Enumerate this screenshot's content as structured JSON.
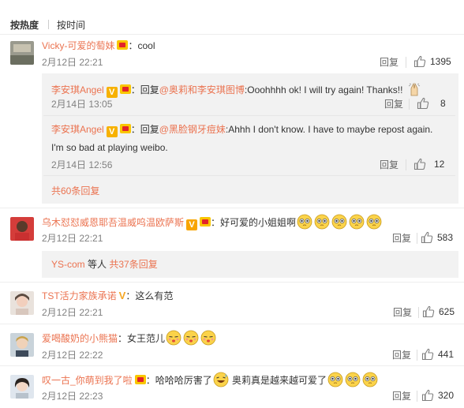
{
  "tabs": {
    "hot": "按热度",
    "time": "按时间"
  },
  "actions": {
    "reply": "回复"
  },
  "comments": [
    {
      "user": "Vicky-可爱的萄妹",
      "colon": "：",
      "text": "cool",
      "time": "2月12日 22:21",
      "likes": "1395",
      "subs": [
        {
          "user": "李安琪Angel",
          "colon": "：回复",
          "mention": "@奥莉和李安琪图博",
          "text": ":Ooohhhh ok! I will try again! Thanks!! ",
          "time": "2月14日 13:05",
          "likes": "8"
        },
        {
          "user": "李安琪Angel",
          "colon": "：回复",
          "mention": "@黑脸钢牙痘妹",
          "text": ":Ahhh I don't know. I have to maybe repost again.",
          "text2": "I'm so bad at playing weibo.",
          "time": "2月14日 12:56",
          "likes": "12"
        }
      ],
      "more": "共60条回复"
    },
    {
      "user": "乌木怼怼威恩耶吾温威呜温欧萨斯",
      "colon": "：",
      "text": "好可爱的小姐姐啊",
      "time": "2月12日 22:21",
      "likes": "583",
      "sub_users": "YS-com",
      "sub_mid": " 等人 ",
      "sub_more": "共37条回复"
    },
    {
      "user": "TST活力家族承诺",
      "colon": "：",
      "text": "这么有范",
      "time": "2月12日 22:21",
      "likes": "625"
    },
    {
      "user": "爱喝酸奶的小熊猫",
      "colon": "：",
      "text": "女王范儿",
      "time": "2月12日 22:22",
      "likes": "441"
    },
    {
      "user": "叹一古_你萌到我了啦",
      "colon": "：",
      "text": "哈哈哈厉害了",
      "text2": " 奥莉真是越来越可爱了",
      "time": "2月12日 22:23",
      "likes": "320"
    }
  ]
}
